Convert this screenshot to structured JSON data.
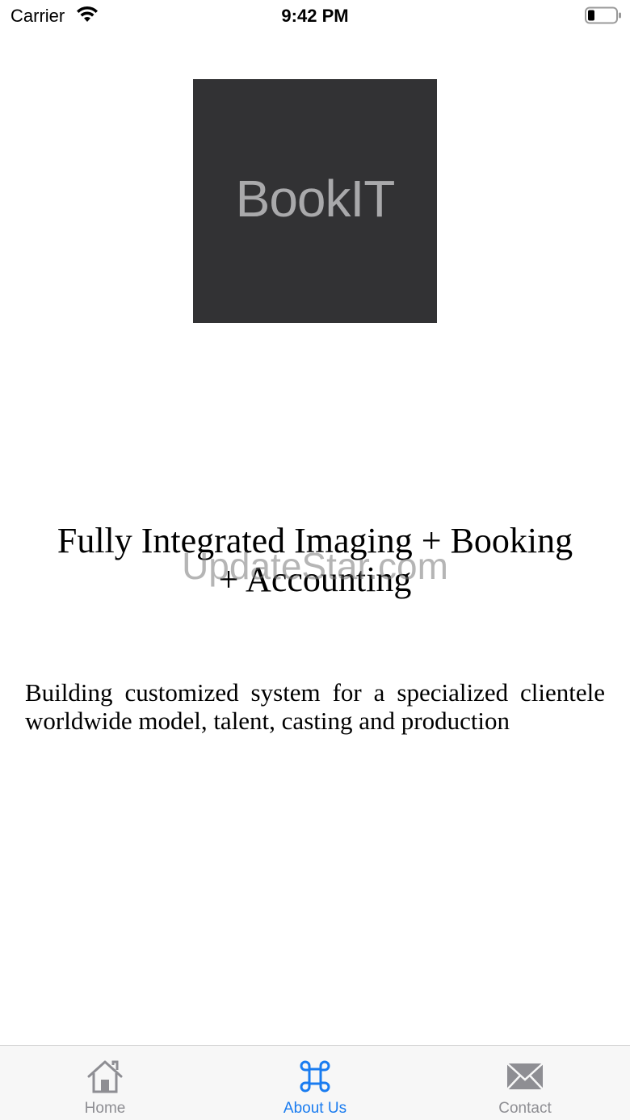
{
  "status_bar": {
    "carrier": "Carrier",
    "time": "9:42 PM"
  },
  "logo": {
    "text": "BookIT",
    "background": "#323234"
  },
  "headline": {
    "line1": "Fully Integrated Imaging + Booking",
    "line2": "+ Accounting"
  },
  "watermark": "UpdateStar.com",
  "description": "Building customized system for a specialized clientele worldwide model, talent, casting and production",
  "tab_bar": {
    "active_color": "#1a7cf0",
    "inactive_color": "#8e8e93",
    "tabs": [
      {
        "label": "Home",
        "icon": "home-icon",
        "active": false
      },
      {
        "label": "About Us",
        "icon": "command-icon",
        "active": true
      },
      {
        "label": "Contact",
        "icon": "envelope-icon",
        "active": false
      }
    ]
  }
}
